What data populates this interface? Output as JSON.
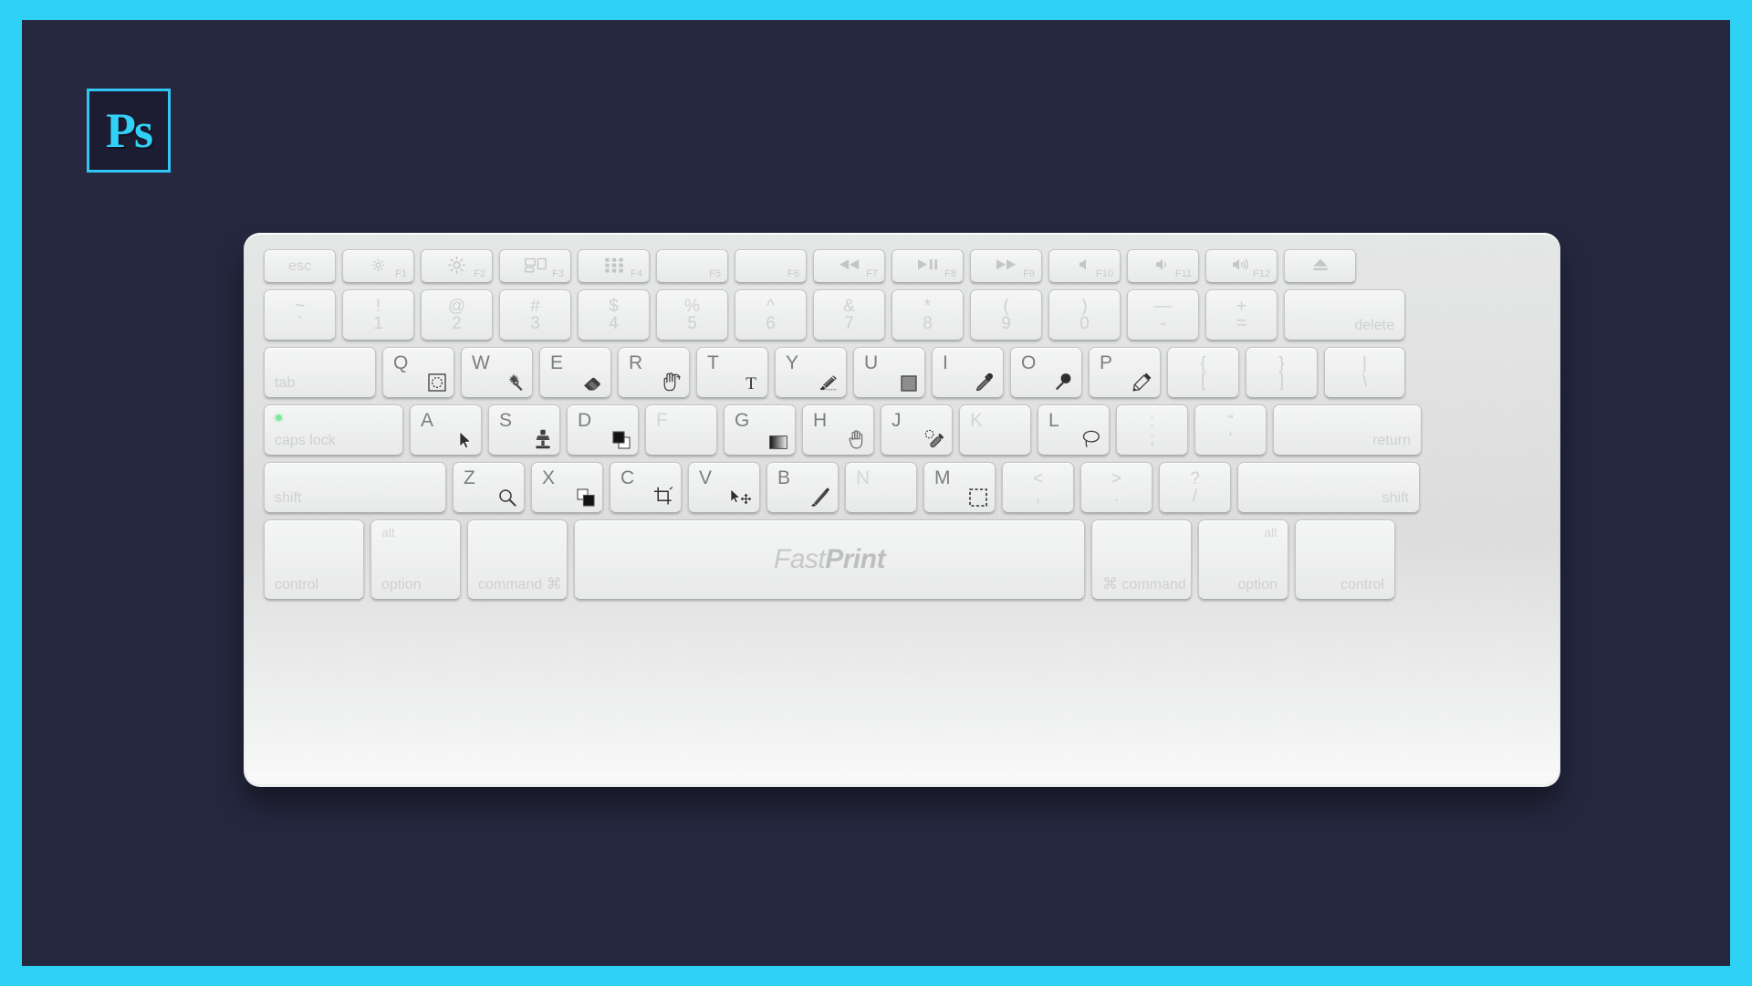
{
  "meta": {
    "background_color": "#262840",
    "border_color": "#2fd2f5",
    "keyboard_brand": "FastPrint"
  },
  "logo": {
    "name": "photoshop-logo",
    "text": "Ps",
    "border_color": "#31c5f4",
    "fill_color": "#1c1d33",
    "text_color": "#32d0f7"
  },
  "space_bar": {
    "brand_light": "Fast",
    "brand_bold": "Print"
  },
  "rows": {
    "function_row": [
      {
        "name": "esc",
        "label": "esc"
      },
      {
        "name": "f1-brightness-down",
        "fn": "F1",
        "icon": "brightness-low-icon"
      },
      {
        "name": "f2-brightness-up",
        "fn": "F2",
        "icon": "brightness-high-icon"
      },
      {
        "name": "f3-mission-control",
        "fn": "F3",
        "icon": "mission-control-icon"
      },
      {
        "name": "f4-launchpad",
        "fn": "F4",
        "icon": "launchpad-icon"
      },
      {
        "name": "f5",
        "fn": "F5",
        "icon": ""
      },
      {
        "name": "f6",
        "fn": "F6",
        "icon": ""
      },
      {
        "name": "f7-rewind",
        "fn": "F7",
        "icon": "rewind-icon"
      },
      {
        "name": "f8-play-pause",
        "fn": "F8",
        "icon": "play-pause-icon"
      },
      {
        "name": "f9-fast-forward",
        "fn": "F9",
        "icon": "fast-forward-icon"
      },
      {
        "name": "f10-mute",
        "fn": "F10",
        "icon": "volume-mute-icon"
      },
      {
        "name": "f11-volume-down",
        "fn": "F11",
        "icon": "volume-down-icon"
      },
      {
        "name": "f12-volume-up",
        "fn": "F12",
        "icon": "volume-up-icon"
      },
      {
        "name": "eject",
        "fn": "",
        "icon": "eject-icon"
      }
    ],
    "number_row": [
      {
        "name": "backtick",
        "top": "~",
        "bottom": "`"
      },
      {
        "name": "one",
        "top": "!",
        "bottom": "1"
      },
      {
        "name": "two",
        "top": "@",
        "bottom": "2"
      },
      {
        "name": "three",
        "top": "#",
        "bottom": "3"
      },
      {
        "name": "four",
        "top": "$",
        "bottom": "4"
      },
      {
        "name": "five",
        "top": "%",
        "bottom": "5"
      },
      {
        "name": "six",
        "top": "^",
        "bottom": "6"
      },
      {
        "name": "seven",
        "top": "&",
        "bottom": "7"
      },
      {
        "name": "eight",
        "top": "*",
        "bottom": "8"
      },
      {
        "name": "nine",
        "top": "(",
        "bottom": "9"
      },
      {
        "name": "zero",
        "top": ")",
        "bottom": "0"
      },
      {
        "name": "minus",
        "top": "—",
        "bottom": "-"
      },
      {
        "name": "equals",
        "top": "+",
        "bottom": "="
      },
      {
        "name": "delete",
        "word": "delete"
      }
    ],
    "qwerty_row": [
      {
        "name": "tab",
        "word": "tab"
      },
      {
        "name": "q",
        "letter": "Q",
        "tool": "quick-mask-icon",
        "tool_label": "Quick Mask"
      },
      {
        "name": "w",
        "letter": "W",
        "tool": "magic-wand-icon",
        "tool_label": "Magic Wand"
      },
      {
        "name": "e",
        "letter": "E",
        "tool": "eraser-icon",
        "tool_label": "Eraser"
      },
      {
        "name": "r",
        "letter": "R",
        "tool": "rotate-view-icon",
        "tool_label": "Rotate View"
      },
      {
        "name": "t",
        "letter": "T",
        "tool": "type-icon",
        "tool_label": "Type"
      },
      {
        "name": "y",
        "letter": "Y",
        "tool": "history-brush-icon",
        "tool_label": "History Brush"
      },
      {
        "name": "u",
        "letter": "U",
        "tool": "shape-icon",
        "tool_label": "Rectangle Shape"
      },
      {
        "name": "i",
        "letter": "I",
        "tool": "eyedropper-icon",
        "tool_label": "Eyedropper"
      },
      {
        "name": "o",
        "letter": "O",
        "tool": "dodge-burn-icon",
        "tool_label": "Dodge / Burn"
      },
      {
        "name": "p",
        "letter": "P",
        "tool": "pen-icon",
        "tool_label": "Pen"
      },
      {
        "name": "bracket-left",
        "top": "{",
        "bottom": "["
      },
      {
        "name": "bracket-right",
        "top": "}",
        "bottom": "]"
      },
      {
        "name": "backslash",
        "top": "|",
        "bottom": "\\"
      }
    ],
    "home_row": [
      {
        "name": "caps-lock",
        "word": "caps lock",
        "led": true
      },
      {
        "name": "a",
        "letter": "A",
        "tool": "path-selection-icon",
        "tool_label": "Path Selection"
      },
      {
        "name": "s",
        "letter": "S",
        "tool": "clone-stamp-icon",
        "tool_label": "Clone Stamp"
      },
      {
        "name": "d",
        "letter": "D",
        "tool": "default-colors-icon",
        "tool_label": "Default Colors"
      },
      {
        "name": "f",
        "letter": "F",
        "dim": true
      },
      {
        "name": "g",
        "letter": "G",
        "tool": "gradient-icon",
        "tool_label": "Gradient"
      },
      {
        "name": "h",
        "letter": "H",
        "tool": "hand-icon",
        "tool_label": "Hand"
      },
      {
        "name": "j",
        "letter": "J",
        "tool": "healing-brush-icon",
        "tool_label": "Healing Brush"
      },
      {
        "name": "k",
        "letter": "K",
        "dim": true
      },
      {
        "name": "l",
        "letter": "L",
        "tool": "lasso-icon",
        "tool_label": "Lasso"
      },
      {
        "name": "semicolon",
        "top": ":",
        "bottom": ";"
      },
      {
        "name": "quote",
        "top": "“",
        "bottom": "‘"
      },
      {
        "name": "return",
        "word": "return"
      }
    ],
    "shift_row": [
      {
        "name": "shift-left",
        "word": "shift"
      },
      {
        "name": "z",
        "letter": "Z",
        "tool": "zoom-icon",
        "tool_label": "Zoom"
      },
      {
        "name": "x",
        "letter": "X",
        "tool": "swap-colors-icon",
        "tool_label": "Swap Colors"
      },
      {
        "name": "c",
        "letter": "C",
        "tool": "crop-icon",
        "tool_label": "Crop"
      },
      {
        "name": "v",
        "letter": "V",
        "tool": "move-icon",
        "tool_label": "Move"
      },
      {
        "name": "b",
        "letter": "B",
        "tool": "brush-icon",
        "tool_label": "Brush"
      },
      {
        "name": "n",
        "letter": "N",
        "dim": true
      },
      {
        "name": "m",
        "letter": "M",
        "tool": "marquee-icon",
        "tool_label": "Marquee"
      },
      {
        "name": "comma",
        "top": "<",
        "bottom": ","
      },
      {
        "name": "period",
        "top": ">",
        "bottom": "."
      },
      {
        "name": "slash",
        "top": "?",
        "bottom": "/"
      },
      {
        "name": "shift-right",
        "word": "shift"
      }
    ],
    "bottom_row": [
      {
        "name": "control-left",
        "word": "control",
        "align": "bl"
      },
      {
        "name": "option-left",
        "word": "option",
        "alt": "alt",
        "align": "bl",
        "alt_align": "tl"
      },
      {
        "name": "command-left",
        "word": "command",
        "symbol": "⌘",
        "align": "bl"
      },
      {
        "name": "space",
        "spacebar": true
      },
      {
        "name": "command-right",
        "symbol": "⌘",
        "word": "command",
        "align": "bl",
        "symbol_first": true
      },
      {
        "name": "option-right",
        "word": "option",
        "alt": "alt",
        "align": "br",
        "alt_align": "tr"
      },
      {
        "name": "control-right",
        "word": "control",
        "align": "br"
      }
    ]
  }
}
